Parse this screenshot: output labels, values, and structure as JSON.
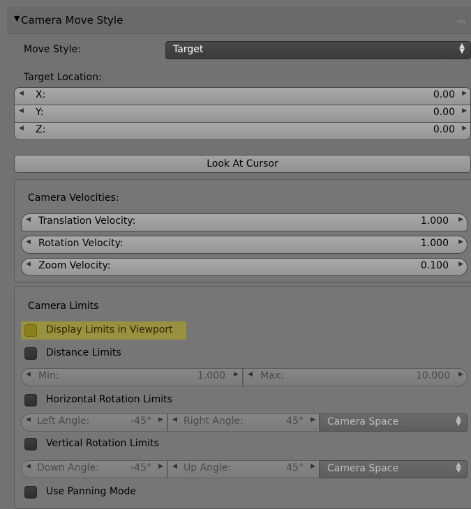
{
  "panel": {
    "title": "Camera Move Style",
    "move_style_label": "Move Style:",
    "move_style_value": "Target",
    "target_location_label": "Target Location:",
    "target": [
      {
        "axis": "X:",
        "value": "0.00"
      },
      {
        "axis": "Y:",
        "value": "0.00"
      },
      {
        "axis": "Z:",
        "value": "0.00"
      }
    ],
    "look_at_cursor": "Look At Cursor"
  },
  "velocities": {
    "heading": "Camera Velocities:",
    "items": [
      {
        "label": "Translation Velocity:",
        "value": "1.000"
      },
      {
        "label": "Rotation Velocity:",
        "value": "1.000"
      },
      {
        "label": "Zoom Velocity:",
        "value": "0.100"
      }
    ]
  },
  "limits": {
    "heading": "Camera Limits",
    "display_limits": "Display Limits in Viewport",
    "distance_limits": "Distance Limits",
    "min_label": "Min:",
    "min_value": "1.000",
    "max_label": "Max:",
    "max_value": "10.000",
    "horizontal": "Horizontal Rotation Limits",
    "left_angle_label": "Left Angle:",
    "left_angle_value": "-45°",
    "right_angle_label": "Right Angle:",
    "right_angle_value": "45°",
    "h_space": "Camera Space",
    "vertical": "Vertical Rotation Limits",
    "down_angle_label": "Down Angle:",
    "down_angle_value": "-45°",
    "up_angle_label": "Up Angle:",
    "up_angle_value": "45°",
    "v_space": "Camera Space",
    "panning": "Use Panning Mode"
  },
  "colors": {
    "panel": "#727272",
    "highlight": "#b3a41c",
    "field": "#a0a0a0",
    "dropdown": "#404040"
  }
}
